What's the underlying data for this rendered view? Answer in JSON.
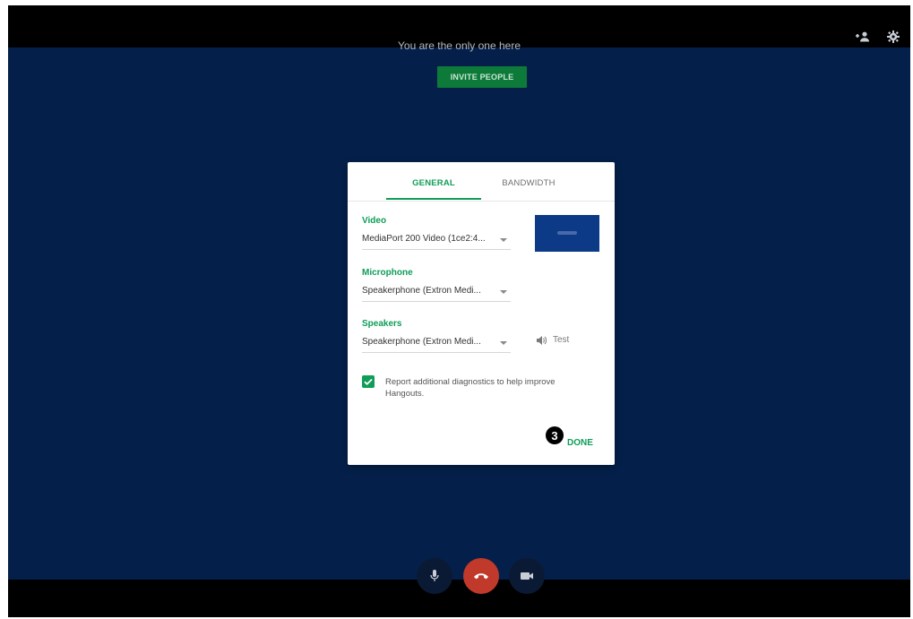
{
  "header": {
    "status_text": "You are the only one here",
    "invite_label": "INVITE PEOPLE",
    "icons": [
      "add-person-icon",
      "gear-icon"
    ]
  },
  "settings_dialog": {
    "tabs": [
      {
        "label": "GENERAL",
        "selected": true
      },
      {
        "label": "BANDWIDTH",
        "selected": false
      }
    ],
    "video": {
      "label": "Video",
      "value": "MediaPort 200 Video (1ce2:4..."
    },
    "microphone": {
      "label": "Microphone",
      "value": "Speakerphone (Extron Medi..."
    },
    "speakers": {
      "label": "Speakers",
      "value": "Speakerphone (Extron Medi..."
    },
    "test_label": "Test",
    "diagnostics": {
      "checked": true,
      "text": "Report additional diagnostics to help improve Hangouts."
    },
    "step_badge": "3",
    "done_label": "DONE"
  },
  "call_controls": {
    "icons": [
      "microphone-icon",
      "hang-up-icon",
      "camera-icon"
    ]
  },
  "colors": {
    "background": "#04204a",
    "accent": "#0f9d58",
    "hangup": "#c0392b"
  }
}
